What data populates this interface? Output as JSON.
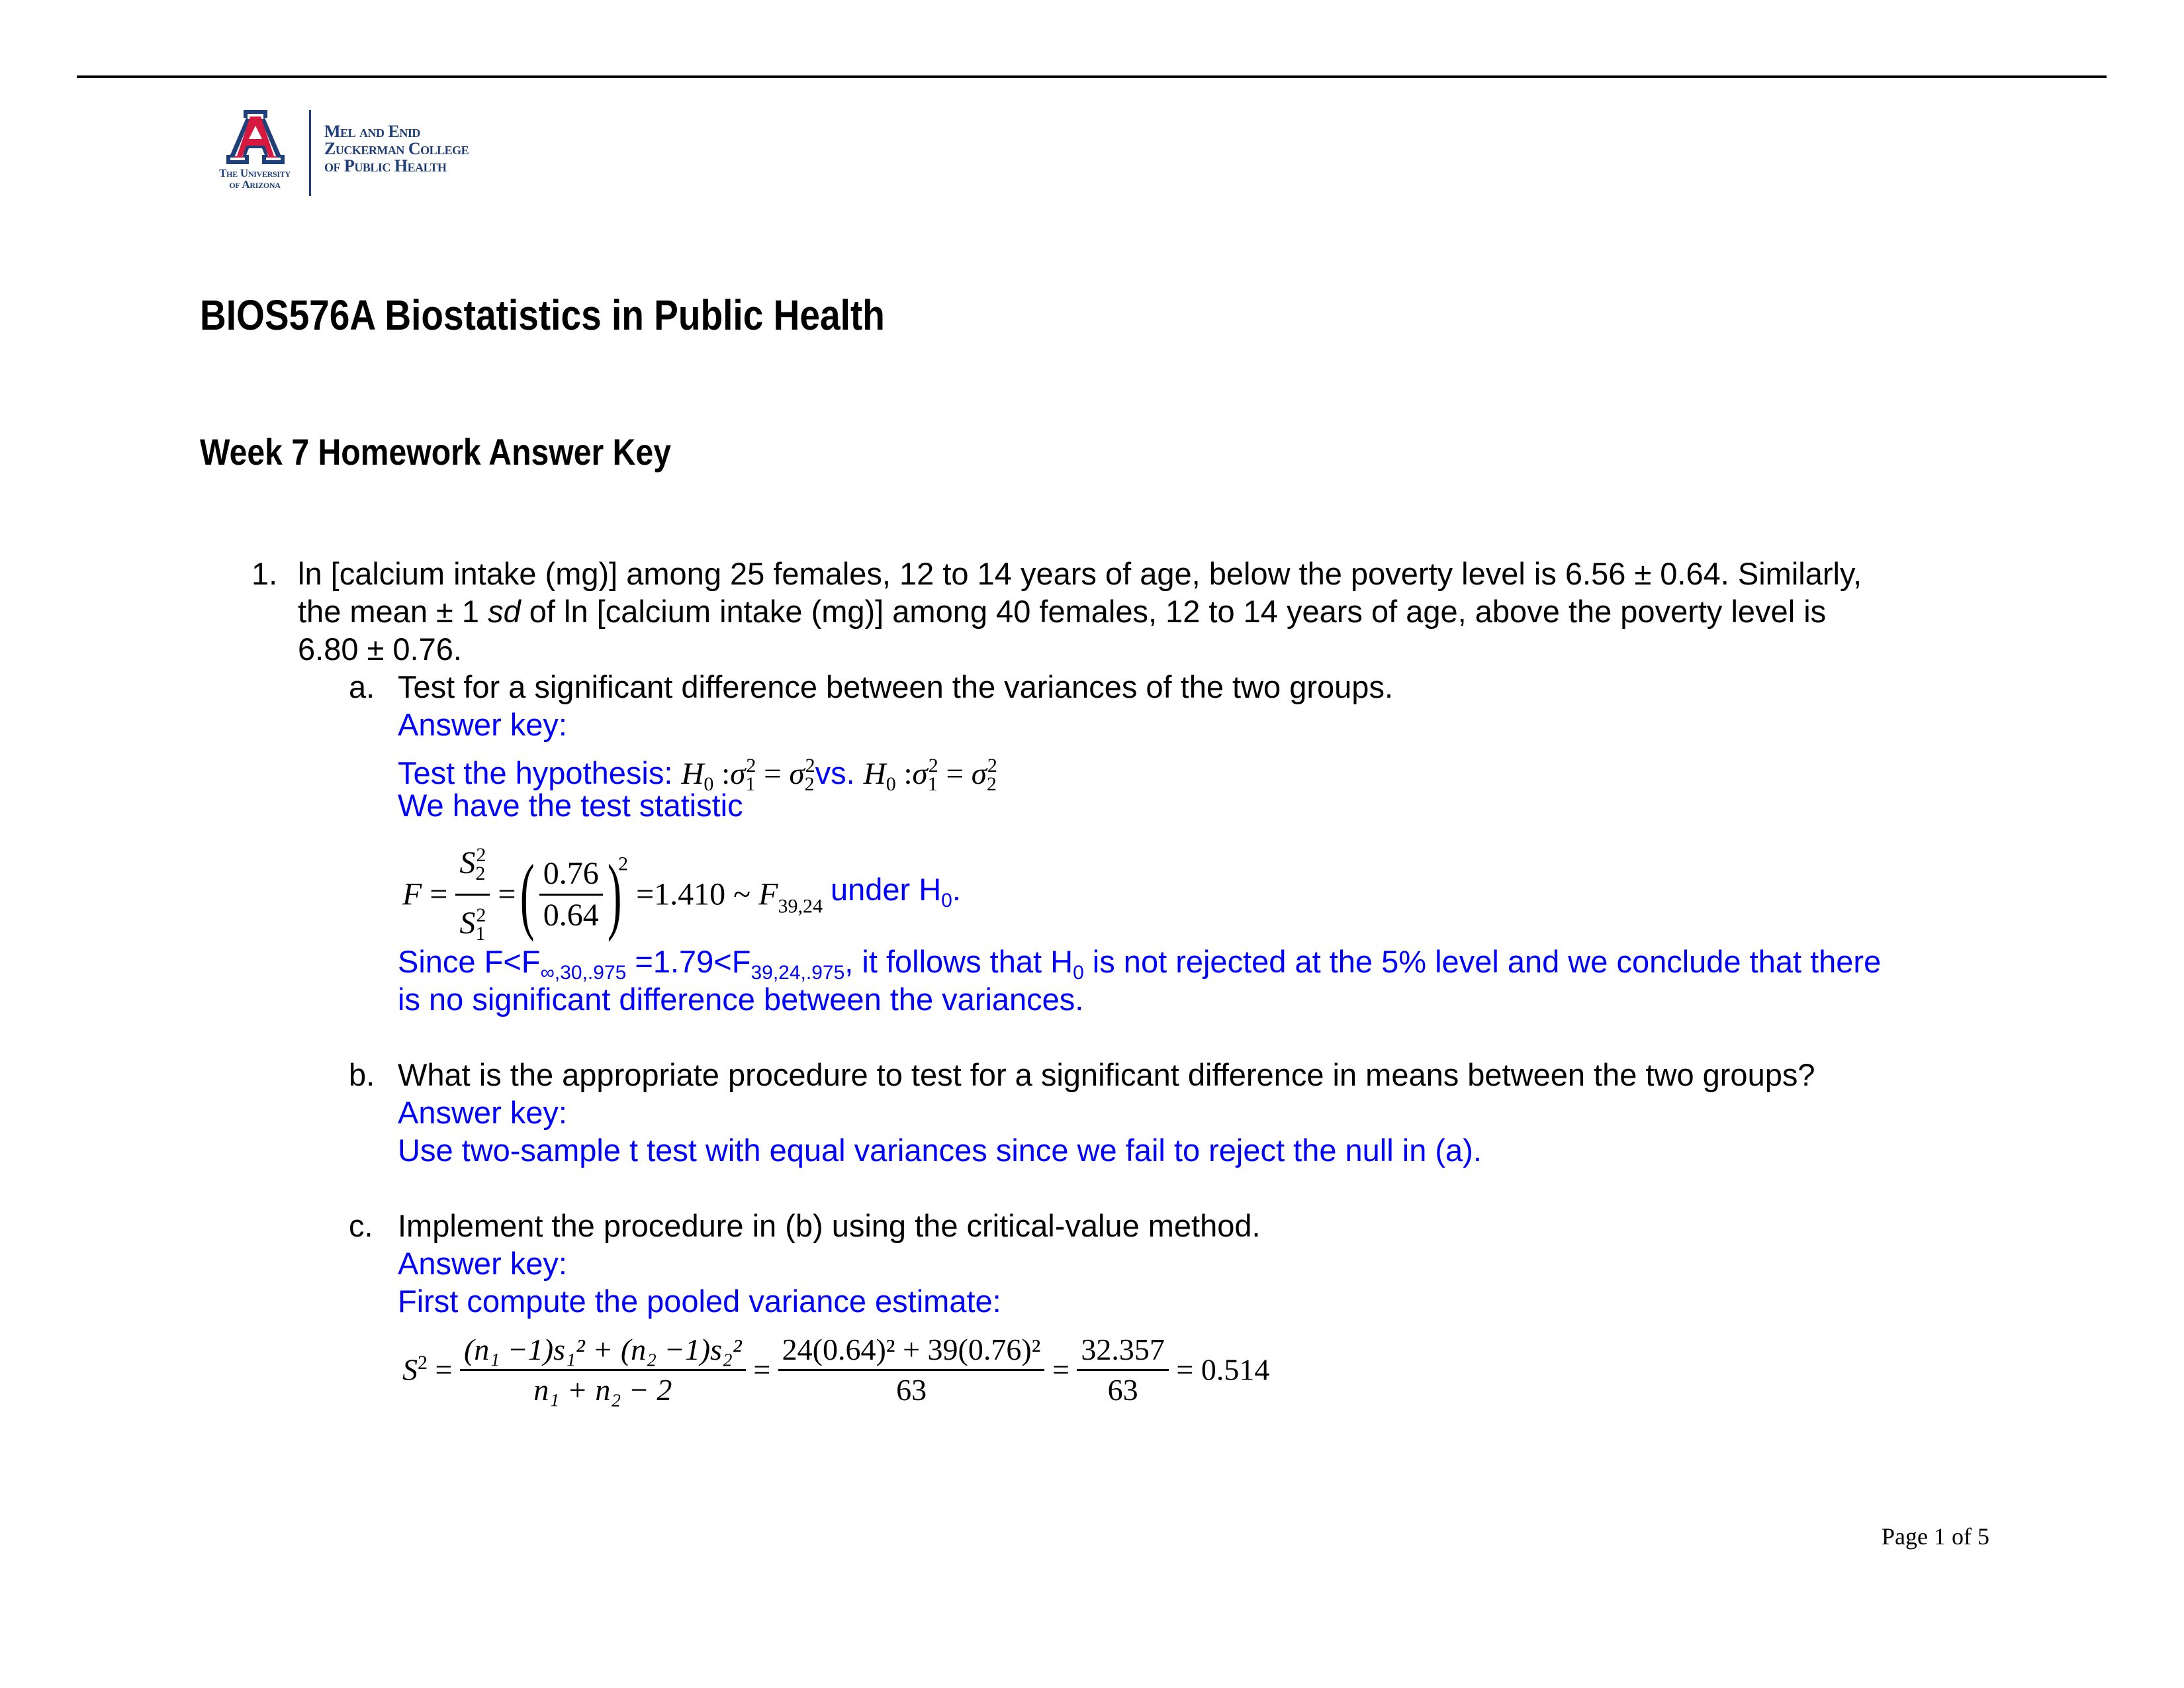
{
  "logo": {
    "university_line1": "The University",
    "university_line2": "of Arizona",
    "college_line1": "Mel and Enid",
    "college_line2": "Zuckerman College",
    "college_line3": "of Public Health",
    "colors": {
      "navy": "#1f3f7a",
      "red": "#d6193f"
    }
  },
  "header": {
    "title": "BIOS576A Biostatistics in Public Health",
    "subtitle": "Week 7 Homework Answer Key"
  },
  "question1": {
    "number": "1.",
    "line1": "ln [calcium intake (mg)] among 25 females, 12 to 14 years of age, below the poverty level is 6.56 ± 0.64. Similarly,",
    "line2_pre": "the mean ± 1 ",
    "line2_italic": "sd",
    "line2_post": " of ln [calcium intake (mg)] among 40 females, 12 to 14 years of age, above the poverty level is",
    "line3": "6.80 ± 0.76.",
    "parts": {
      "a": {
        "label": "a.",
        "question": "Test for a significant difference between the variances of the two groups.",
        "answer_key_label": "Answer key:",
        "hypothesis_intro": "Test the hypothesis:",
        "hyp_vs": "vs.",
        "hyp_H": "H",
        "hyp_0": "0",
        "hyp_colon": " :",
        "sigma": "σ",
        "one": "1",
        "two": "2",
        "eq": " = ",
        "test_stat_intro": "We have the test statistic",
        "F": "F",
        "S": "S",
        "num_val": "0.76",
        "den_val": "0.64",
        "f_result": "=1.410 ~ ",
        "f_df": "39,24",
        "under": " under H",
        "under_sub": "0",
        "under_end": ".",
        "conclusion_pre": "Since F<F",
        "conclusion_sub1": "∞,30,.975",
        "conclusion_mid": " =1.79<F",
        "conclusion_sub2": "39,24,.975",
        "conclusion_post1": ", it follows that H",
        "conclusion_sub3": "0",
        "conclusion_post2": " is not rejected at the 5% level and we conclude that there",
        "conclusion_line2": "is no significant difference between the variances."
      },
      "b": {
        "label": "b.",
        "question": "What is the appropriate procedure to test for a significant difference in means between the two groups?",
        "answer_key_label": "Answer key:",
        "answer": "Use two-sample t test with equal variances since we fail to reject the null in (a)."
      },
      "c": {
        "label": "c.",
        "question": "Implement the procedure in (b) using the critical-value method.",
        "answer_key_label": "Answer key:",
        "pooled_intro": "First compute the pooled variance estimate:",
        "S2_lhs": "S",
        "formula_num": "(n₁ −1)s₁² + (n₂ −1)s₂²",
        "formula_den": "n₁ + n₂ − 2",
        "sub_num": "24(0.64)² + 39(0.76)²",
        "sub_den": "63",
        "sum_num": "32.357",
        "sum_den": "63",
        "result": "= 0.514"
      }
    }
  },
  "footer": {
    "page": "Page 1 of 5"
  }
}
